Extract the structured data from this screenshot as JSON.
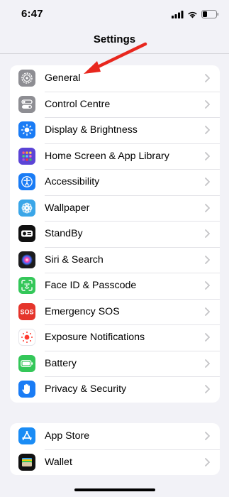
{
  "status": {
    "time": "6:47",
    "icons": [
      "signal-icon",
      "wifi-icon",
      "battery-icon"
    ]
  },
  "nav": {
    "title": "Settings"
  },
  "main_group": [
    {
      "label": "General",
      "icon": "gear-icon",
      "color": "#8e8e93"
    },
    {
      "label": "Control Centre",
      "icon": "toggles-icon",
      "color": "#8e8e93"
    },
    {
      "label": "Display & Brightness",
      "icon": "sun-icon",
      "color": "#1a7cf5"
    },
    {
      "label": "Home Screen & App Library",
      "icon": "app-grid-icon",
      "color": "#5b44d6"
    },
    {
      "label": "Accessibility",
      "icon": "accessibility-icon",
      "color": "#1a7cf5"
    },
    {
      "label": "Wallpaper",
      "icon": "flower-icon",
      "color": "#3aa6e8"
    },
    {
      "label": "StandBy",
      "icon": "standby-icon",
      "color": "#111111"
    },
    {
      "label": "Siri & Search",
      "icon": "siri-icon",
      "color": "#1c1c1e"
    },
    {
      "label": "Face ID & Passcode",
      "icon": "face-id-icon",
      "color": "#34c759"
    },
    {
      "label": "Emergency SOS",
      "icon": "sos-icon",
      "color": "#e5352c"
    },
    {
      "label": "Exposure Notifications",
      "icon": "exposure-icon",
      "color": "#ffffff"
    },
    {
      "label": "Battery",
      "icon": "battery-icon",
      "color": "#34c759"
    },
    {
      "label": "Privacy & Security",
      "icon": "hand-icon",
      "color": "#1a7cf5"
    }
  ],
  "store_group": [
    {
      "label": "App Store",
      "icon": "app-store-icon",
      "color": "#1a8cf5"
    },
    {
      "label": "Wallet",
      "icon": "wallet-icon",
      "color": "#111111"
    }
  ],
  "annotation": {
    "arrow_color": "#e8271e"
  }
}
